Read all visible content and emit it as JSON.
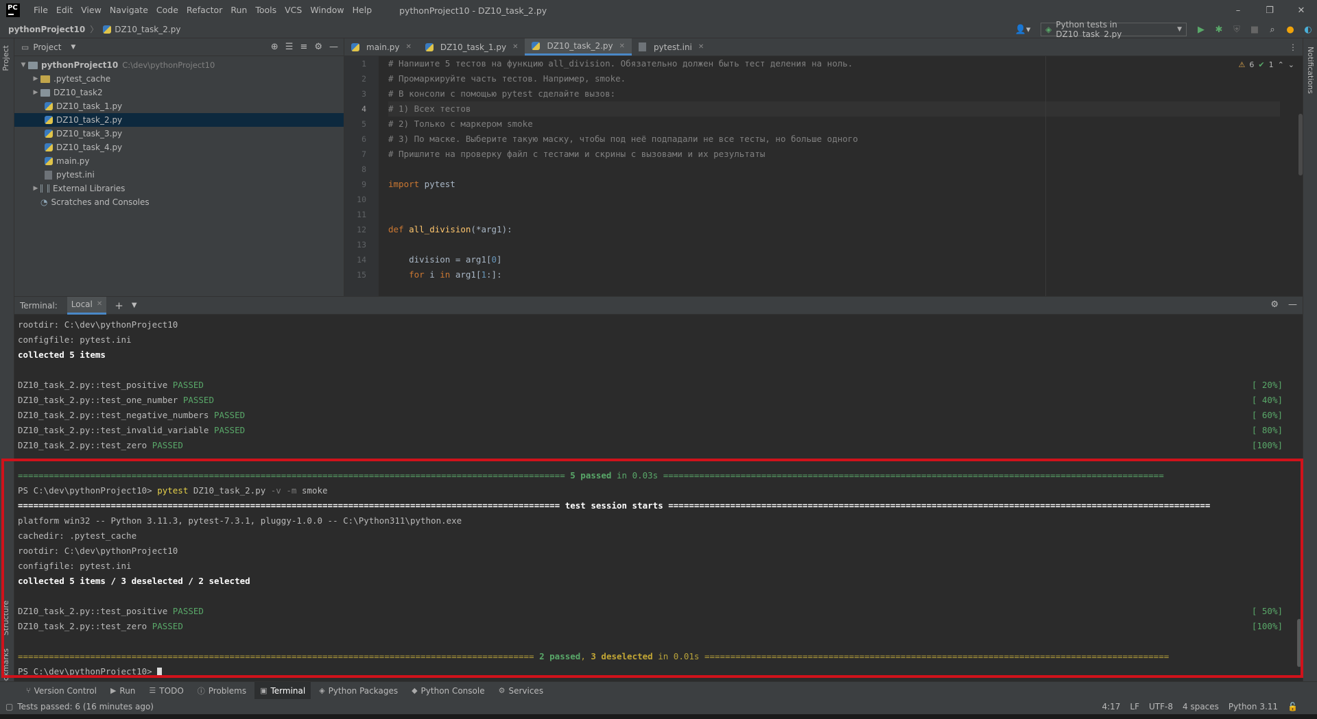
{
  "window": {
    "title": "pythonProject10 - DZ10_task_2.py",
    "menu": [
      "File",
      "Edit",
      "View",
      "Navigate",
      "Code",
      "Refactor",
      "Run",
      "Tools",
      "VCS",
      "Window",
      "Help"
    ],
    "app_logo": "PC",
    "controls": {
      "minimize": "–",
      "restore": "❐",
      "close": "✕"
    }
  },
  "nav": {
    "project": "pythonProject10",
    "file": "DZ10_task_2.py",
    "run_config": "Python tests in DZ10_task_2.py"
  },
  "left_strip": {
    "project_tab": "Project",
    "structure_tab": "Structure",
    "bookmarks_tab": "Bookmarks"
  },
  "right_strip": {
    "notifications_tab": "Notifications"
  },
  "project_panel": {
    "title": "Project",
    "root": {
      "name": "pythonProject10",
      "path": "C:\\dev\\pythonProject10"
    },
    "items": [
      {
        "name": ".pytest_cache",
        "kind": "folder"
      },
      {
        "name": "DZ10_task2",
        "kind": "folder"
      },
      {
        "name": "DZ10_task_1.py",
        "kind": "py"
      },
      {
        "name": "DZ10_task_2.py",
        "kind": "py"
      },
      {
        "name": "DZ10_task_3.py",
        "kind": "py"
      },
      {
        "name": "DZ10_task_4.py",
        "kind": "py"
      },
      {
        "name": "main.py",
        "kind": "py"
      },
      {
        "name": "pytest.ini",
        "kind": "ini"
      }
    ],
    "external_libraries": "External Libraries",
    "scratches": "Scratches and Consoles"
  },
  "editor": {
    "tabs": [
      {
        "label": "main.py",
        "active": false
      },
      {
        "label": "DZ10_task_1.py",
        "active": false
      },
      {
        "label": "DZ10_task_2.py",
        "active": true
      },
      {
        "label": "pytest.ini",
        "active": false
      }
    ],
    "inspections": {
      "warnings": "6",
      "ok": "1"
    },
    "line_numbers": [
      "1",
      "2",
      "3",
      "4",
      "5",
      "6",
      "7",
      "8",
      "9",
      "10",
      "11",
      "12",
      "13",
      "14",
      "15"
    ],
    "lines": [
      "# Напишите 5 тестов на функцию all_division. Обязательно должен быть тест деления на ноль.",
      "# Промаркируйте часть тестов. Например, smoke.",
      "# В консоли с помощью pytest сделайте вызов:",
      "# 1) Всех тестов",
      "# 2) Только с маркером smoke",
      "# 3) По маске. Выберите такую маску, чтобы под неё подпадали не все тесты, но больше одного",
      "# Пришлите на проверку файл с тестами и скрины с вызовами и их результаты",
      "",
      "import pytest",
      "",
      "",
      "def all_division(*arg1):",
      "",
      "    division = arg1[0]",
      "    for i in arg1[1:]:"
    ]
  },
  "terminal": {
    "label": "Terminal:",
    "tab": "Local",
    "lines_top": {
      "rootdir": "rootdir: C:\\dev\\pythonProject10",
      "configfile": "configfile: pytest.ini",
      "collected": "collected 5 items"
    },
    "results_1": [
      {
        "name": "DZ10_task_2.py::test_positive",
        "status": "PASSED",
        "pct": "[ 20%]"
      },
      {
        "name": "DZ10_task_2.py::test_one_number",
        "status": "PASSED",
        "pct": "[ 40%]"
      },
      {
        "name": "DZ10_task_2.py::test_negative_numbers",
        "status": "PASSED",
        "pct": "[ 60%]"
      },
      {
        "name": "DZ10_task_2.py::test_invalid_variable",
        "status": "PASSED",
        "pct": "[ 80%]"
      },
      {
        "name": "DZ10_task_2.py::test_zero",
        "status": "PASSED",
        "pct": "[100%]"
      }
    ],
    "summary_1": {
      "passed": "5 passed",
      "time": " in 0.03s "
    },
    "prompt": "PS C:\\dev\\pythonProject10>",
    "command": {
      "exe": "pytest",
      "file": " DZ10_task_2.py ",
      "flags": "-v -m",
      "arg": " smoke"
    },
    "session_start": " test session starts ",
    "platform": "platform win32 -- Python 3.11.3, pytest-7.3.1, pluggy-1.0.0 -- C:\\Python311\\python.exe",
    "cachedir": "cachedir: .pytest_cache",
    "rootdir": "rootdir: C:\\dev\\pythonProject10",
    "configfile": "configfile: pytest.ini",
    "collected": "collected 5 items / 3 deselected / 2 selected",
    "results_2": [
      {
        "name": "DZ10_task_2.py::test_positive",
        "status": "PASSED",
        "pct": "[ 50%]"
      },
      {
        "name": "DZ10_task_2.py::test_zero",
        "status": "PASSED",
        "pct": "[100%]"
      }
    ],
    "summary_2": {
      "passed": "2 passed",
      "comma": ", ",
      "deselected": "3 deselected",
      "time": " in 0.01s "
    },
    "final_prompt": "PS C:\\dev\\pythonProject10> "
  },
  "toolwindows": [
    {
      "label": "Version Control",
      "icon": "branch-icon"
    },
    {
      "label": "Run",
      "icon": "play-icon"
    },
    {
      "label": "TODO",
      "icon": "list-icon"
    },
    {
      "label": "Problems",
      "icon": "info-icon"
    },
    {
      "label": "Terminal",
      "icon": "terminal-icon",
      "active": true
    },
    {
      "label": "Python Packages",
      "icon": "layers-icon"
    },
    {
      "label": "Python Console",
      "icon": "python-icon"
    },
    {
      "label": "Services",
      "icon": "gear-icon"
    }
  ],
  "status": {
    "message": "Tests passed: 6 (16 minutes ago)",
    "position": "4:17",
    "line_sep": "LF",
    "encoding": "UTF-8",
    "indent": "4 spaces",
    "interpreter": "Python 3.11"
  },
  "colors": {
    "accent": "#4a88c7",
    "pass": "#59a869",
    "warn": "#c3a735",
    "highlight": "#d0121b"
  }
}
